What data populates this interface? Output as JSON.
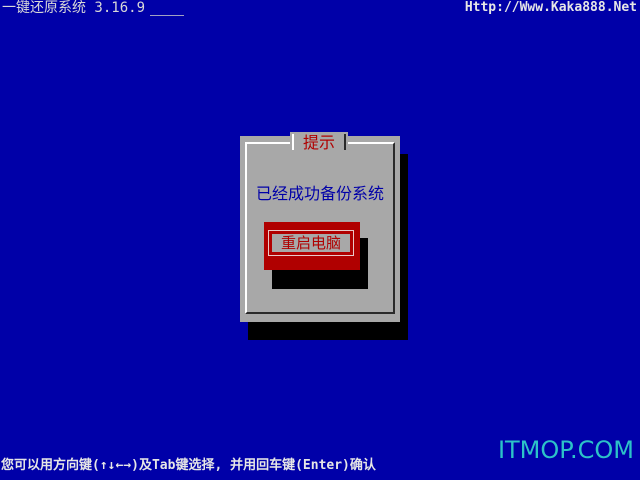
{
  "header": {
    "app_title": "一键还原系统 3.16.9",
    "website": "Http://Www.Kaka888.Net"
  },
  "dialog": {
    "title": "提示",
    "message": "已经成功备份系统",
    "button_label": "重启电脑"
  },
  "footer": {
    "hint": "您可以用方向键(↑↓←→)及Tab键选择, 并用回车键(Enter)确认",
    "watermark": "ITMOP.COM"
  },
  "colors": {
    "background": "#0000a8",
    "dialog": "#a8a8a8",
    "accent_red": "#b00000",
    "watermark": "#2cc2c8"
  }
}
